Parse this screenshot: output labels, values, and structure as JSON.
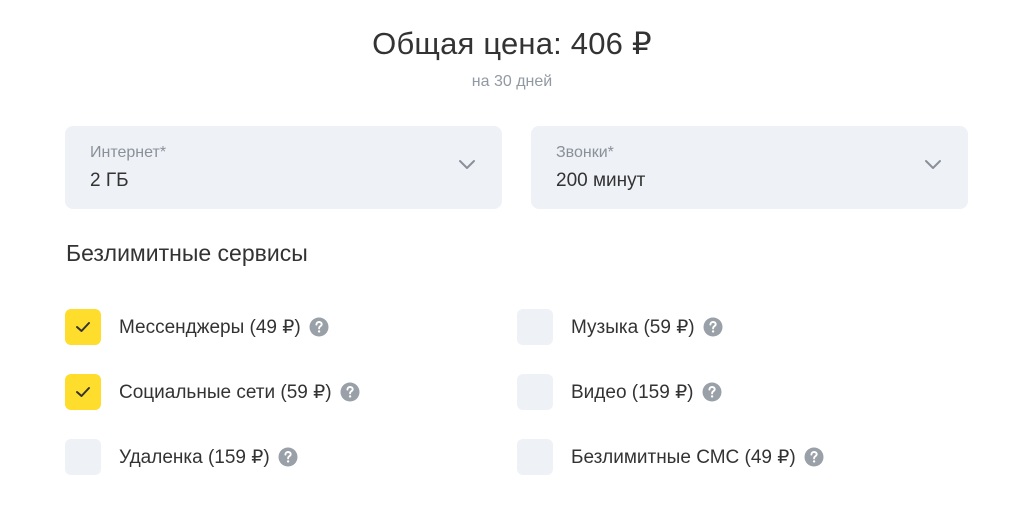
{
  "summary": {
    "total_label": "Общая цена: 406 ₽",
    "period": "на 30 дней"
  },
  "selects": {
    "internet": {
      "label": "Интернет*",
      "value": "2 ГБ"
    },
    "calls": {
      "label": "Звонки*",
      "value": "200 минут"
    }
  },
  "services": {
    "title": "Безлимитные сервисы",
    "items": [
      {
        "label": "Мессенджеры (49 ₽)",
        "checked": true
      },
      {
        "label": "Музыка (59 ₽)",
        "checked": false
      },
      {
        "label": "Социальные сети (59 ₽)",
        "checked": true
      },
      {
        "label": "Видео (159 ₽)",
        "checked": false
      },
      {
        "label": "Удаленка (159 ₽)",
        "checked": false
      },
      {
        "label": "Безлимитные СМС (49 ₽)",
        "checked": false
      }
    ]
  },
  "colors": {
    "accent_yellow": "#ffdd2d",
    "field_bg": "#eef1f6",
    "text_main": "#333333",
    "text_muted": "#9299a2",
    "help_icon": "#9aa0a8"
  },
  "icons": {
    "dropdown": "chevron-down-icon",
    "check": "check-icon",
    "help": "question-circle-icon"
  }
}
